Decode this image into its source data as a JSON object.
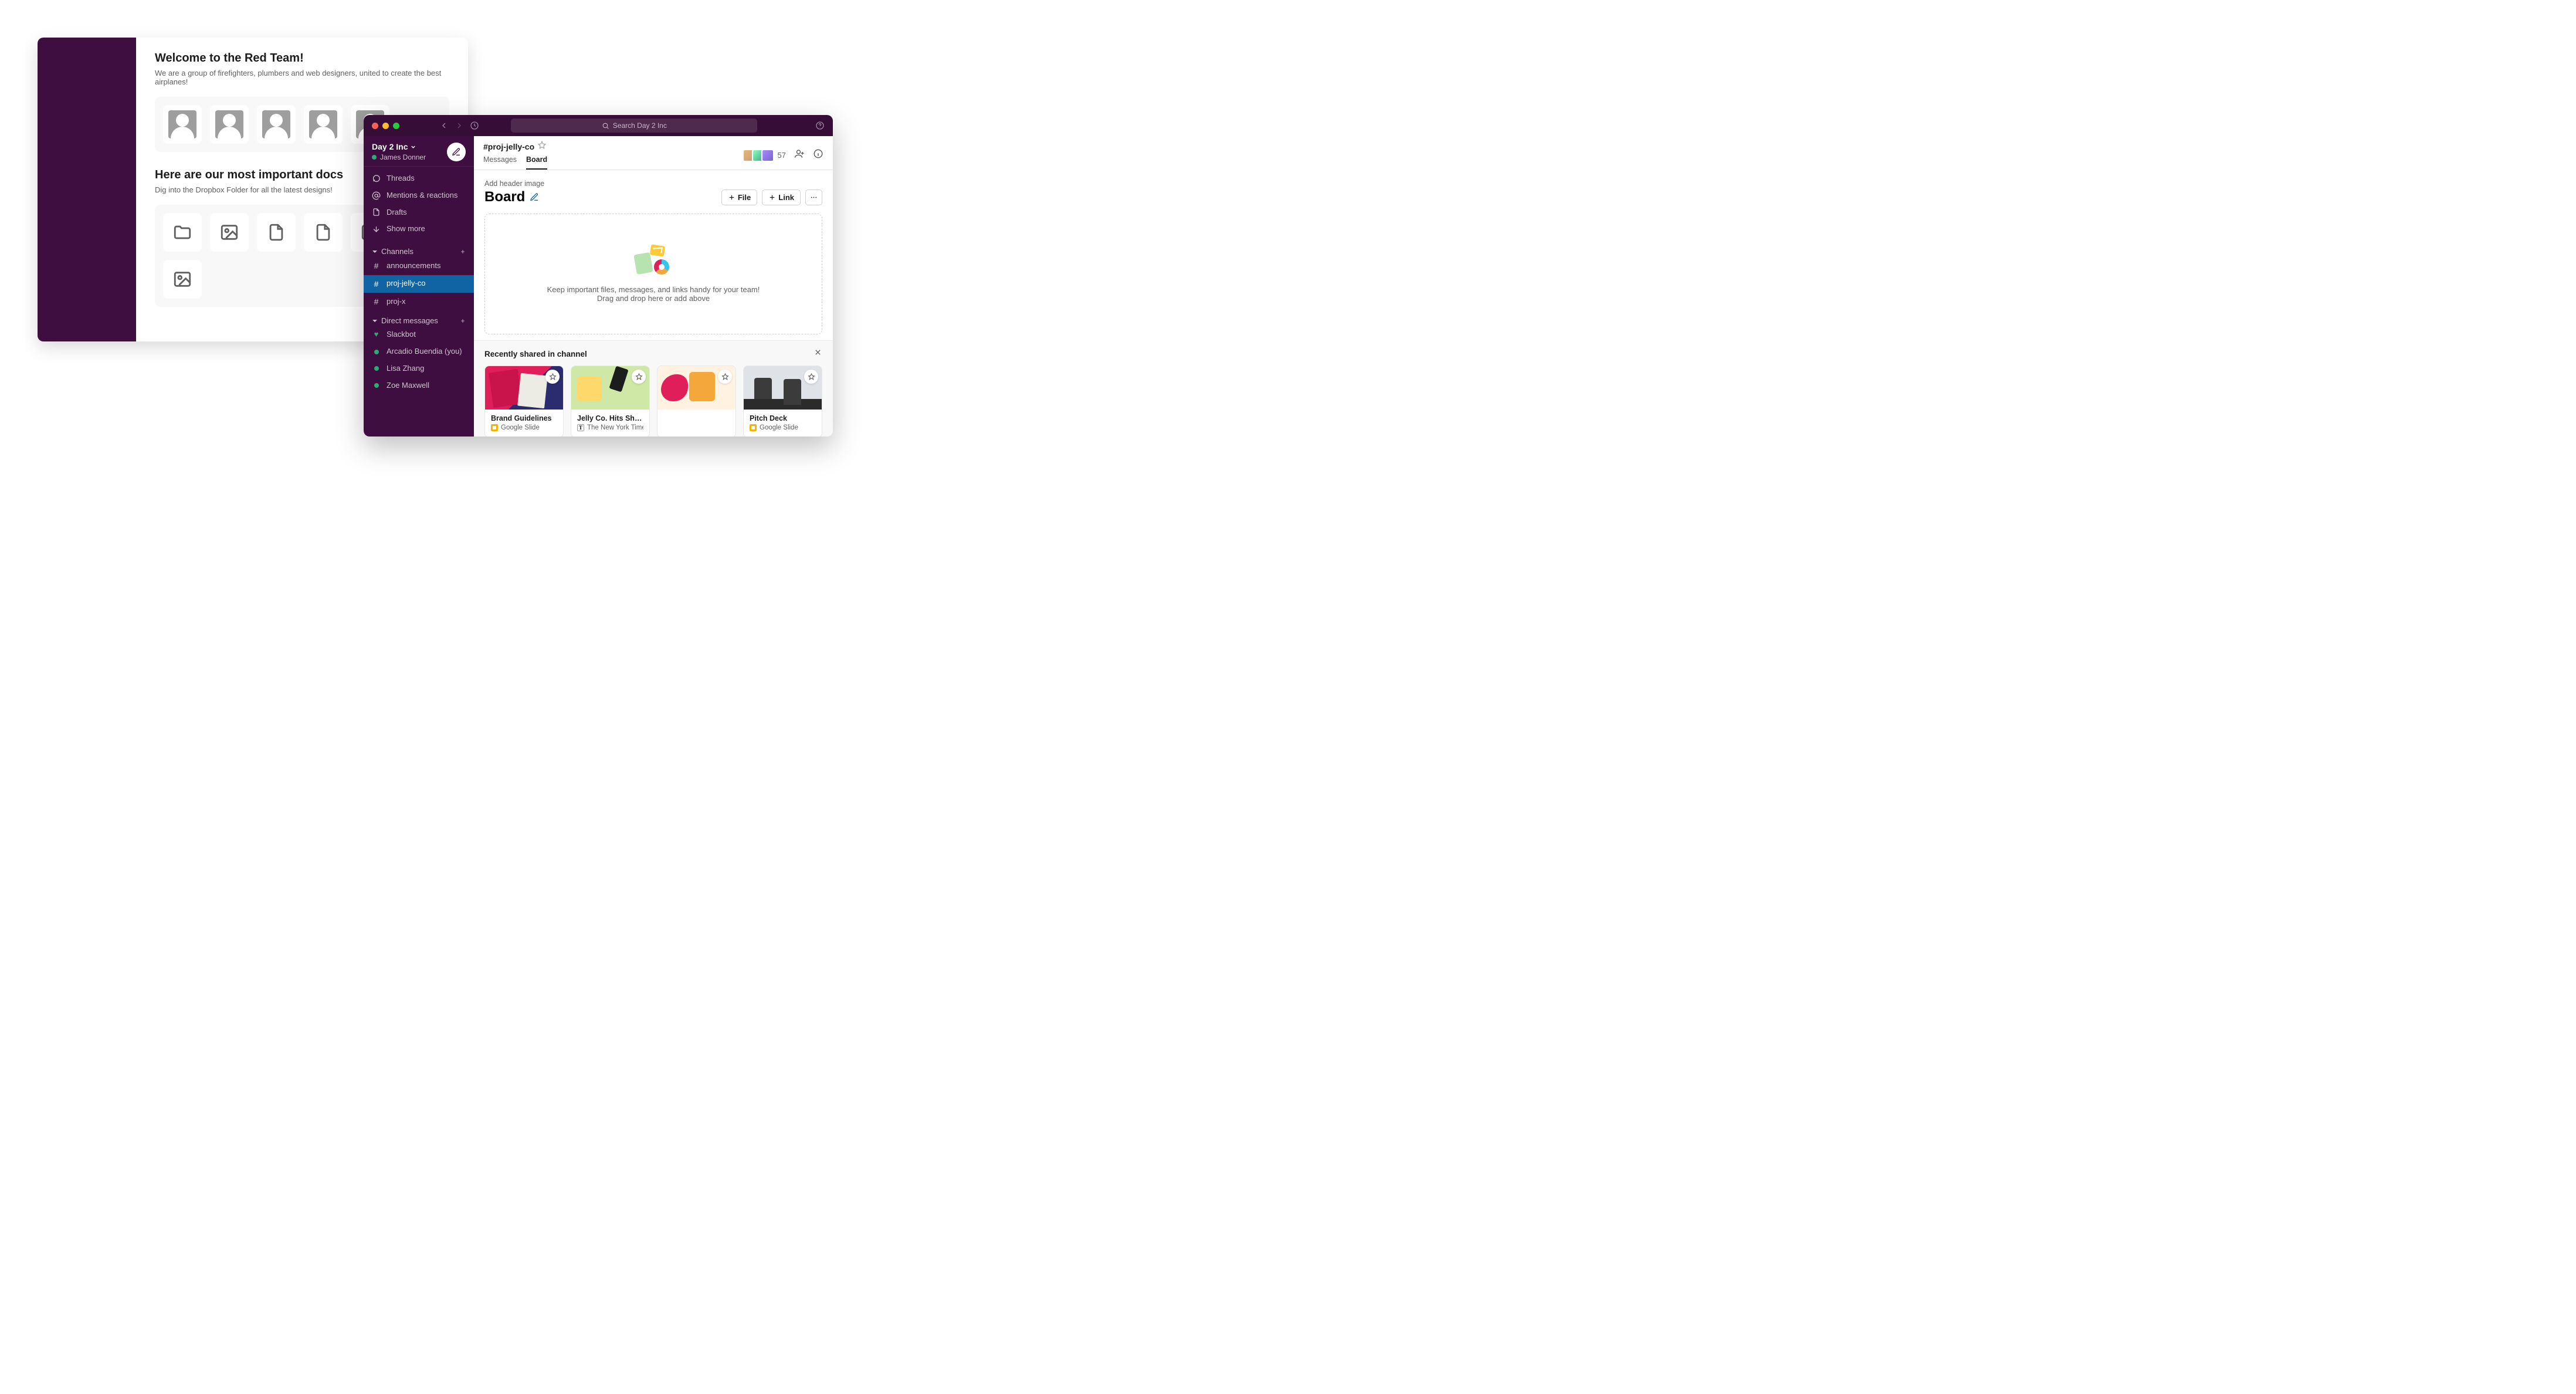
{
  "canvas": {
    "welcome_title": "Welcome to the Red Team!",
    "welcome_sub": "We are a group of firefighters, plumbers and web designers, united to create the best airplanes!",
    "docs_title": "Here are our most important docs",
    "docs_sub": "Dig into the Dropbox Folder for all the latest designs!"
  },
  "topbar": {
    "search_placeholder": "Search Day 2 Inc"
  },
  "workspace": {
    "name": "Day 2 Inc",
    "user": "James Donner"
  },
  "sidebar": {
    "threads": "Threads",
    "mentions": "Mentions & reactions",
    "drafts": "Drafts",
    "show_more": "Show more",
    "channels_label": "Channels",
    "channels": [
      {
        "name": "announcements",
        "active": false
      },
      {
        "name": "proj-jelly-co",
        "active": true
      },
      {
        "name": "proj-x",
        "active": false
      }
    ],
    "dms_label": "Direct messages",
    "dms": [
      {
        "name": "Slackbot",
        "kind": "heart"
      },
      {
        "name": "Arcadio Buendia (you)",
        "kind": "dot"
      },
      {
        "name": "Lisa Zhang",
        "kind": "dot"
      },
      {
        "name": "Zoe Maxwell",
        "kind": "dot"
      }
    ]
  },
  "channel": {
    "name": "#proj-jelly-co",
    "tabs": {
      "messages": "Messages",
      "board": "Board"
    },
    "member_count": "57"
  },
  "board": {
    "add_header": "Add header image",
    "title": "Board",
    "file_btn": "File",
    "link_btn": "Link",
    "dz_line1": "Keep important files, messages, and links handy for your team!",
    "dz_line2": "Drag and drop here or add above"
  },
  "recent": {
    "title": "Recently shared in channel",
    "cards": [
      {
        "title": "Brand Guidelines",
        "source": "Google Slide",
        "source_kind": "gslide"
      },
      {
        "title": "Jelly Co. Hits Shelve…",
        "source": "The New York Times",
        "source_kind": "nyt"
      },
      {
        "title": "",
        "source": "",
        "source_kind": ""
      },
      {
        "title": "Pitch Deck",
        "source": "Google Slide",
        "source_kind": "gslide"
      }
    ]
  }
}
